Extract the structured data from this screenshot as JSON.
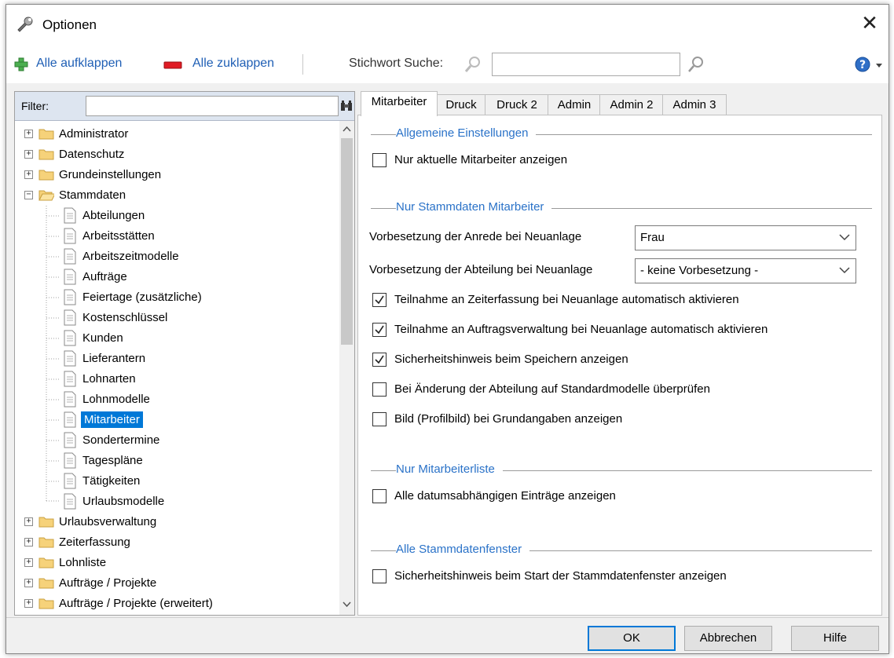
{
  "window": {
    "title": "Optionen",
    "icon": "wrench-icon",
    "close_glyph": "✕"
  },
  "toolbar": {
    "expand_all": "Alle aufklappen",
    "collapse_all": "Alle zuklappen",
    "keyword_search_label": "Stichwort Suche:",
    "search_value": "",
    "help_icon": "help-icon"
  },
  "filter": {
    "label": "Filter:",
    "value": ""
  },
  "tree": {
    "top_items": [
      {
        "label": "Administrator"
      },
      {
        "label": "Datenschutz"
      },
      {
        "label": "Grundeinstellungen"
      }
    ],
    "expanded": {
      "label": "Stammdaten"
    },
    "children": [
      {
        "label": "Abteilungen"
      },
      {
        "label": "Arbeitsstätten"
      },
      {
        "label": "Arbeitszeitmodelle"
      },
      {
        "label": "Aufträge"
      },
      {
        "label": "Feiertage (zusätzliche)"
      },
      {
        "label": "Kostenschlüssel"
      },
      {
        "label": "Kunden"
      },
      {
        "label": "Lieferantern"
      },
      {
        "label": "Lohnarten"
      },
      {
        "label": "Lohnmodelle"
      },
      {
        "label": "Mitarbeiter",
        "selected": true
      },
      {
        "label": "Sondertermine"
      },
      {
        "label": "Tagespläne"
      },
      {
        "label": "Tätigkeiten"
      },
      {
        "label": "Urlaubsmodelle"
      }
    ],
    "bottom_items": [
      {
        "label": "Urlaubsverwaltung"
      },
      {
        "label": "Zeiterfassung"
      },
      {
        "label": "Lohnliste"
      },
      {
        "label": "Aufträge / Projekte"
      },
      {
        "label": "Aufträge / Projekte (erweitert)"
      }
    ]
  },
  "tabs": [
    {
      "label": "Mitarbeiter",
      "active": true
    },
    {
      "label": "Druck"
    },
    {
      "label": "Druck 2"
    },
    {
      "label": "Admin"
    },
    {
      "label": "Admin 2"
    },
    {
      "label": "Admin 3"
    }
  ],
  "groups": {
    "general": {
      "title": "Allgemeine Einstellungen",
      "options": [
        {
          "label": "Nur aktuelle Mitarbeiter anzeigen",
          "checked": false
        }
      ]
    },
    "master_data": {
      "title": "Nur Stammdaten Mitarbeiter",
      "salutation_label": "Vorbesetzung der Anrede bei Neuanlage",
      "salutation_value": "Frau",
      "department_label": "Vorbesetzung der Abteilung bei Neuanlage",
      "department_value": "- keine Vorbesetzung -",
      "options": [
        {
          "label": "Teilnahme an Zeiterfassung bei Neuanlage automatisch aktivieren",
          "checked": true
        },
        {
          "label": "Teilnahme an Auftragsverwaltung bei Neuanlage automatisch aktivieren",
          "checked": true
        },
        {
          "label": "Sicherheitshinweis beim Speichern anzeigen",
          "checked": true
        },
        {
          "label": "Bei Änderung der Abteilung auf Standardmodelle überprüfen",
          "checked": false
        },
        {
          "label": "Bild (Profilbild) bei Grundangaben anzeigen",
          "checked": false
        }
      ]
    },
    "employee_list": {
      "title": "Nur Mitarbeiterliste",
      "options": [
        {
          "label": "Alle datumsabhängigen Einträge anzeigen",
          "checked": false
        }
      ]
    },
    "all_windows": {
      "title": "Alle Stammdatenfenster",
      "options": [
        {
          "label": "Sicherheitshinweis beim Start der Stammdatenfenster anzeigen",
          "checked": false
        }
      ]
    }
  },
  "buttons": {
    "ok": "OK",
    "cancel": "Abbrechen",
    "help": "Hilfe"
  },
  "colors": {
    "accent": "#0078d7",
    "group_title": "#2a72c8",
    "link": "#1f5fb5",
    "selection": "#0078d7"
  }
}
